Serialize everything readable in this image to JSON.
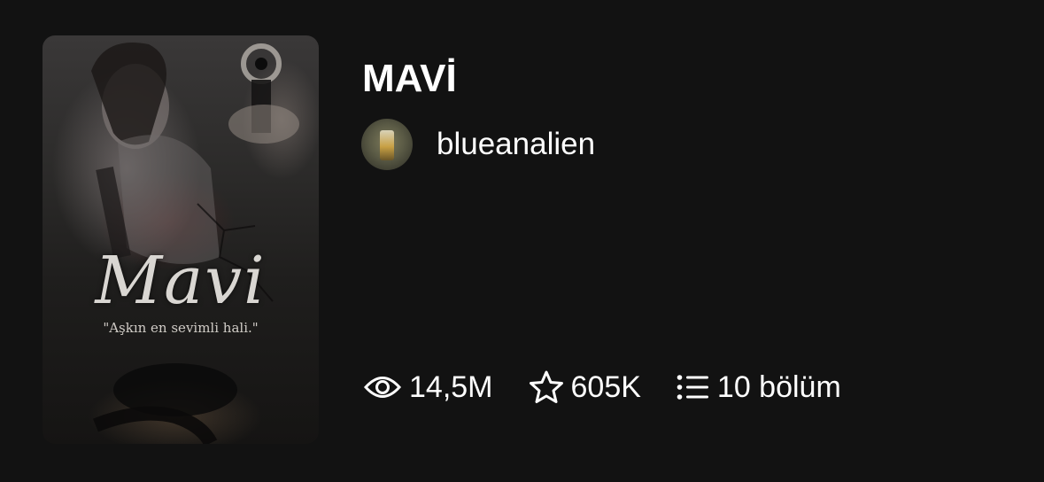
{
  "story": {
    "title": "MAVİ",
    "cover": {
      "title": "Mavi",
      "tagline": "\"Aşkın en sevimli hali.\""
    },
    "author": {
      "name": "blueanalien"
    },
    "stats": {
      "reads": {
        "icon": "eye-icon",
        "value": "14,5M"
      },
      "votes": {
        "icon": "star-icon",
        "value": "605K"
      },
      "parts": {
        "icon": "list-icon",
        "value": "10 bölüm"
      }
    }
  },
  "colors": {
    "background": "#121212",
    "text": "#ffffff"
  }
}
